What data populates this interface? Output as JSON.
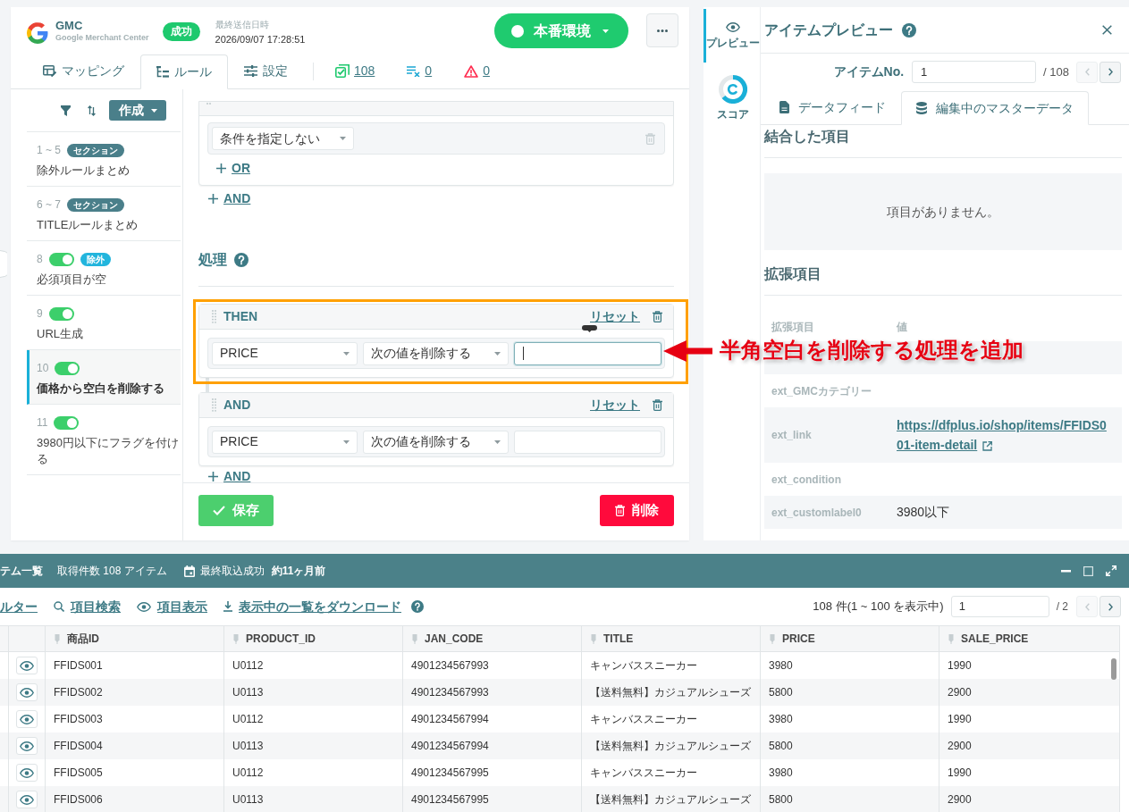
{
  "header": {
    "logo_title": "GMC",
    "logo_subtitle": "Google Merchant Center",
    "status": "成功",
    "last_sent_label": "最終送信日時",
    "last_sent": "2026/09/07 17:28:51",
    "environment": "本番環境"
  },
  "tabs": [
    {
      "kind": "mapping",
      "label": "マッピング",
      "selected": false
    },
    {
      "kind": "rules",
      "label": "ルール",
      "selected": true
    },
    {
      "kind": "settings",
      "label": "設定",
      "selected": false
    }
  ],
  "counters": [
    {
      "kind": "valid",
      "value": "108"
    },
    {
      "kind": "excluded",
      "value": "0"
    },
    {
      "kind": "error",
      "value": "0"
    }
  ],
  "sidebar": {
    "create_button": "作成",
    "rules": [
      {
        "kind": "section",
        "number": "1 ~ 5",
        "badge": "セクション",
        "title": "除外ルールまとめ",
        "selected": false
      },
      {
        "kind": "section",
        "number": "6 ~ 7",
        "badge": "セクション",
        "title": "TITLEルールまとめ",
        "selected": false
      },
      {
        "kind": "rule",
        "number": "8",
        "on": true,
        "badge": "除外",
        "title": "必須項目が空",
        "selected": false
      },
      {
        "kind": "rule",
        "number": "9",
        "on": true,
        "title": "URL生成",
        "selected": false
      },
      {
        "kind": "rule",
        "number": "10",
        "on": true,
        "title": "価格から空白を削除する",
        "selected": true
      },
      {
        "kind": "rule",
        "number": "11",
        "on": true,
        "title": "3980円以下にフラグを付ける",
        "selected": false
      }
    ]
  },
  "conditions": {
    "rows": [
      {
        "field": "条件を指定しない"
      }
    ],
    "add_or": "OR",
    "add_and": "AND"
  },
  "processing": {
    "heading": "処理",
    "blocks": [
      {
        "label": "THEN",
        "reset": "リセット",
        "field": "PRICE",
        "operation": "次の値を削除する",
        "focused": true
      },
      {
        "label": "AND",
        "reset": "リセット",
        "field": "PRICE",
        "operation": "次の値を削除する",
        "focused": false
      }
    ],
    "add_and": "AND"
  },
  "actions": {
    "save": "保存",
    "delete": "削除"
  },
  "annotation": {
    "text": "半角空白を削除する処理を追加"
  },
  "preview": {
    "rail": [
      {
        "kind": "preview",
        "label": "プレビュー",
        "selected": true
      },
      {
        "kind": "score",
        "label": "スコア",
        "selected": false
      }
    ],
    "title": "アイテムプレビュー",
    "item_no_label": "アイテムNo.",
    "item_no": "1",
    "item_total": "/ 108",
    "prev_disabled": true,
    "next_disabled": false,
    "tabs": [
      {
        "kind": "file",
        "label": "データフィード",
        "selected": false
      },
      {
        "kind": "database",
        "label": "編集中のマスターデータ",
        "selected": true
      }
    ],
    "merged_heading": "結合した項目",
    "merged_empty": "項目がありません。",
    "extended_heading": "拡張項目",
    "extended_columns": [
      "拡張項目",
      "値"
    ],
    "extended_rows": [
      {
        "kind": "covered"
      },
      {
        "kind": "empty",
        "name": "ext_GMCカテゴリー"
      },
      {
        "kind": "link",
        "name": "ext_link",
        "value": "https://dfplus.io/shop/items/FFIDS001-item-detail"
      },
      {
        "kind": "empty",
        "name": "ext_condition"
      },
      {
        "kind": "text",
        "name": "ext_customlabel0",
        "value": "3980以下"
      }
    ]
  },
  "item_list": {
    "title": "テム一覧",
    "count": "取得件数 108 アイテム",
    "import_label": "最終取込成功",
    "import_time": "約11ヶ月前",
    "tools": [
      {
        "kind": "filter",
        "label": "ルター"
      },
      {
        "kind": "search",
        "label": "項目検索"
      },
      {
        "kind": "columns",
        "label": "項目表示"
      },
      {
        "kind": "download",
        "label": "表示中の一覧をダウンロード"
      }
    ],
    "range": "108 件(1 ~ 100 を表示中)",
    "page": "1",
    "pages": "/ 2",
    "prev_disabled": true,
    "next_disabled": false,
    "columns": [
      "商品ID",
      "PRODUCT_ID",
      "JAN_CODE",
      "TITLE",
      "PRICE",
      "SALE_PRICE"
    ],
    "rows": [
      [
        "FFIDS001",
        "U0112",
        "4901234567993",
        "キャンバススニーカー",
        "3980",
        "1990"
      ],
      [
        "FFIDS002",
        "U0113",
        "4901234567993",
        "【送料無料】カジュアルシューズ",
        "5800",
        "2900"
      ],
      [
        "FFIDS003",
        "U0112",
        "4901234567994",
        "キャンバススニーカー",
        "3980",
        "1990"
      ],
      [
        "FFIDS004",
        "U0113",
        "4901234567994",
        "【送料無料】カジュアルシューズ",
        "5800",
        "2900"
      ],
      [
        "FFIDS005",
        "U0112",
        "4901234567995",
        "キャンバススニーカー",
        "3980",
        "1990"
      ],
      [
        "FFIDS006",
        "U0113",
        "4901234567995",
        "【送料無料】カジュアルシューズ",
        "5800",
        "2900"
      ]
    ]
  }
}
